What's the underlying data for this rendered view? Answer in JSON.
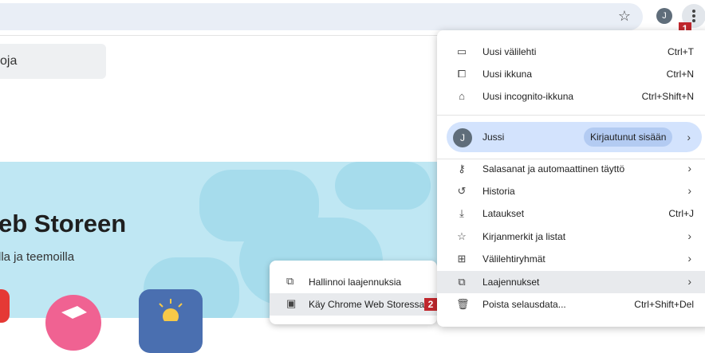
{
  "toolbar": {
    "bookmark_icon": "star-icon",
    "avatar_letter": "J",
    "menu_icon": "more-vert-icon",
    "badge_1": "1"
  },
  "page": {
    "search_text": "oja",
    "hero_title": "eb Storeen",
    "hero_subtitle": "lla ja teemoilla"
  },
  "main_menu": {
    "items": [
      {
        "icon": "new-tab-icon",
        "label": "Uusi välilehti",
        "shortcut": "Ctrl+T"
      },
      {
        "icon": "new-window-icon",
        "label": "Uusi ikkuna",
        "shortcut": "Ctrl+N"
      },
      {
        "icon": "incognito-icon",
        "label": "Uusi incognito-ikkuna",
        "shortcut": "Ctrl+Shift+N"
      }
    ],
    "profile": {
      "avatar_letter": "J",
      "name": "Jussi",
      "status": "Kirjautunut sisään"
    },
    "items2": [
      {
        "icon": "key-icon",
        "label": "Salasanat ja automaattinen täyttö",
        "shortcut": ""
      },
      {
        "icon": "history-icon",
        "label": "Historia",
        "shortcut": ""
      },
      {
        "icon": "download-icon",
        "label": "Lataukset",
        "shortcut": "Ctrl+J"
      },
      {
        "icon": "bookmark-star-icon",
        "label": "Kirjanmerkit ja listat",
        "shortcut": ""
      },
      {
        "icon": "grid-icon",
        "label": "Välilehtiryhmät",
        "shortcut": ""
      },
      {
        "icon": "puzzle-icon",
        "label": "Laajennukset",
        "shortcut": ""
      },
      {
        "icon": "trash-icon",
        "label": "Poista selausdata...",
        "shortcut": "Ctrl+Shift+Del"
      }
    ]
  },
  "extensions_submenu": {
    "items": [
      {
        "icon": "puzzle-icon",
        "label": "Hallinnoi laajennuksia"
      },
      {
        "icon": "web-store-icon",
        "label": "Käy Chrome Web Storessa"
      }
    ],
    "badge_2": "2"
  },
  "colors": {
    "hero_bg": "#bfe7f3",
    "menu_highlight": "#e8eaed",
    "profile_bg": "#d3e3fd",
    "badge": "#c0272d"
  }
}
